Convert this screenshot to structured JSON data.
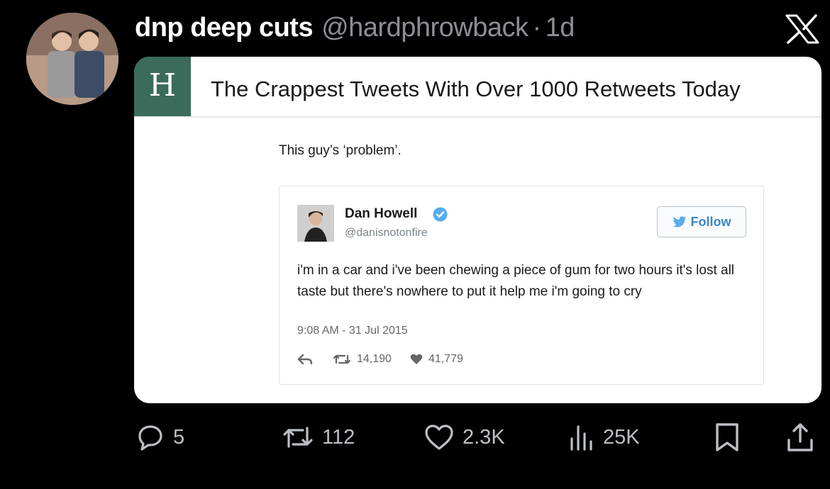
{
  "post": {
    "display_name": "dnp deep cuts",
    "handle": "@hardphrowback",
    "separator": "·",
    "age": "1d"
  },
  "card": {
    "site_logo_letter": "H",
    "title": "The Crappest Tweets With Over 1000 Retweets Today",
    "caption": "This guy’s ‘problem’."
  },
  "embedded_tweet": {
    "name": "Dan Howell",
    "handle": "@danisnotonfire",
    "follow_label": "Follow",
    "text": "i'm in a car and i've been chewing a piece of gum for two hours it's lost all taste but there's nowhere to put it help me i'm going to cry",
    "timestamp": "9:08 AM - 31 Jul 2015",
    "retweets": "14,190",
    "likes": "41,779"
  },
  "actions": {
    "replies": "5",
    "reposts": "112",
    "likes": "2.3K",
    "views": "25K"
  },
  "colors": {
    "background": "#000000",
    "muted_text": "#8b8f94",
    "brand_green": "#3b6b5a",
    "twitter_blue": "#3b88c3"
  },
  "icons": [
    "x-logo-icon",
    "verified-badge-icon",
    "bird-icon",
    "reply-icon",
    "retweet-icon",
    "heart-icon",
    "views-icon",
    "bookmark-icon",
    "share-icon"
  ]
}
